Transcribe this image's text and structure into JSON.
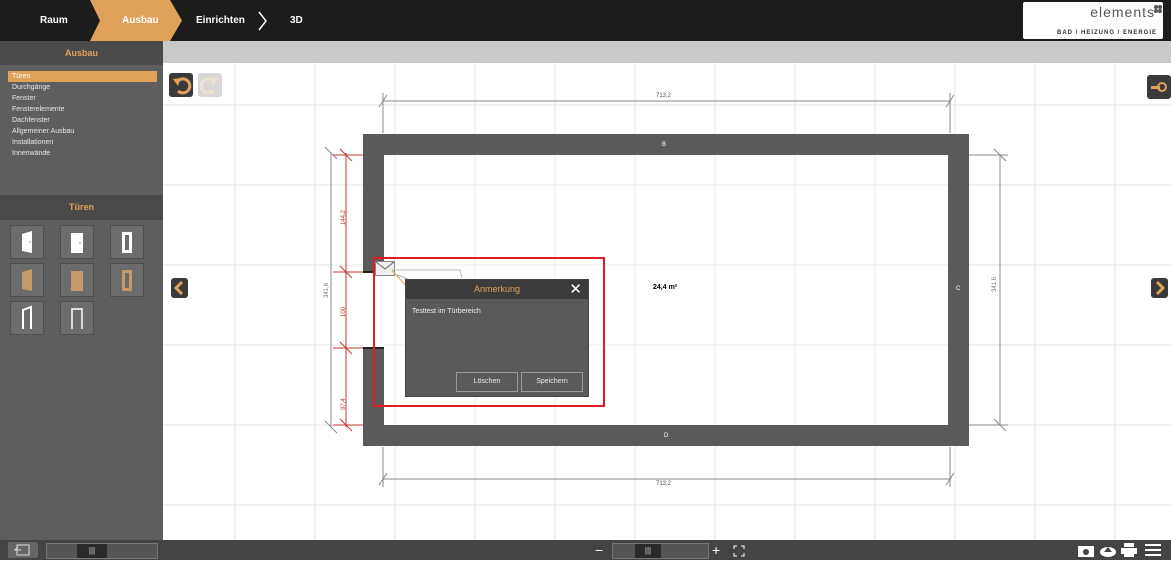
{
  "topbar": {
    "steps": [
      "Raum",
      "Ausbau",
      "Einrichten",
      "3D"
    ],
    "brand_name": "elements",
    "brand_sub": "BAD / HEIZUNG / ENERGIE"
  },
  "sidebar": {
    "section_title": "Ausbau",
    "menu": [
      "Türen",
      "Durchgänge",
      "Fenster",
      "Fensterelemente",
      "Dachfenster",
      "Allgemeiner Ausbau",
      "Installationen",
      "Innenwände"
    ],
    "doors_title": "Türen"
  },
  "plan": {
    "dim_top": "713,2",
    "dim_bottom": "713,2",
    "dim_left_total": "341,6",
    "dim_right_total": "341,6",
    "dim_left_a": "144,2",
    "dim_left_b": "100",
    "dim_left_c": "97,4",
    "wall_b": "B",
    "wall_c": "C",
    "wall_d": "D",
    "area": "24,4 m²"
  },
  "dialog": {
    "title": "Anmerkung",
    "text": "Testtest im Türbereich",
    "delete": "Löschen",
    "save": "Speichern"
  },
  "colors": {
    "accent": "#e0a25a",
    "dark": "#1c1c1c",
    "sidebar": "#5e5e5e",
    "wall": "#5a5a5a",
    "highlight": "#e01b24"
  }
}
